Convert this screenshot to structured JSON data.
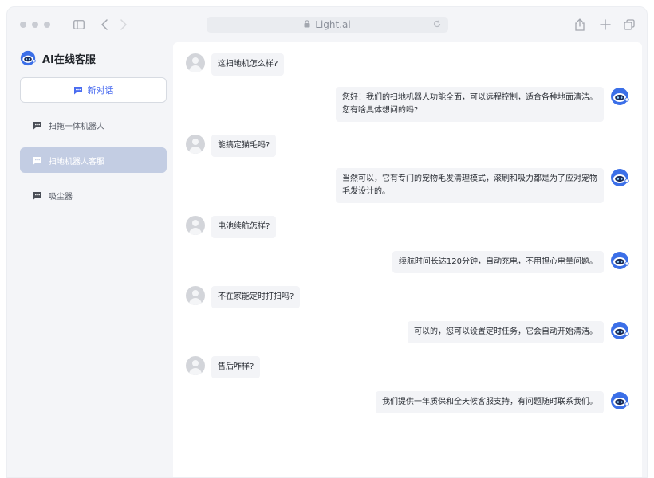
{
  "browser": {
    "url": "Light.ai"
  },
  "sidebar": {
    "brand": "AI在线客服",
    "new_chat": "新对话",
    "conversations": [
      {
        "label": "扫拖一体机器人"
      },
      {
        "label": "扫地机器人客服",
        "active": true
      },
      {
        "label": "吸尘器"
      }
    ]
  },
  "messages": [
    {
      "role": "user",
      "text": "这扫地机怎么样?"
    },
    {
      "role": "bot",
      "text": "您好！我们的扫地机器人功能全面，可以远程控制，适合各种地面清洁。您有啥具体想问的吗?"
    },
    {
      "role": "user",
      "text": "能搞定猫毛吗?"
    },
    {
      "role": "bot",
      "text": "当然可以，它有专门的宠物毛发清理模式，滚刷和吸力都是为了应对宠物毛发设计的。"
    },
    {
      "role": "user",
      "text": "电池续航怎样?"
    },
    {
      "role": "bot",
      "text": "续航时间长达120分钟，自动充电，不用担心电量问题。"
    },
    {
      "role": "user",
      "text": "不在家能定时打扫吗?"
    },
    {
      "role": "bot",
      "text": "可以的，您可以设置定时任务，它会自动开始清洁。"
    },
    {
      "role": "user",
      "text": "售后咋样?"
    },
    {
      "role": "bot",
      "text": "我们提供一年质保和全天候客服支持，有问题随时联系我们。"
    }
  ],
  "colors": {
    "accent": "#4a6cf0",
    "active_conv": "#c3cde3",
    "bubble": "#f3f4f7"
  }
}
